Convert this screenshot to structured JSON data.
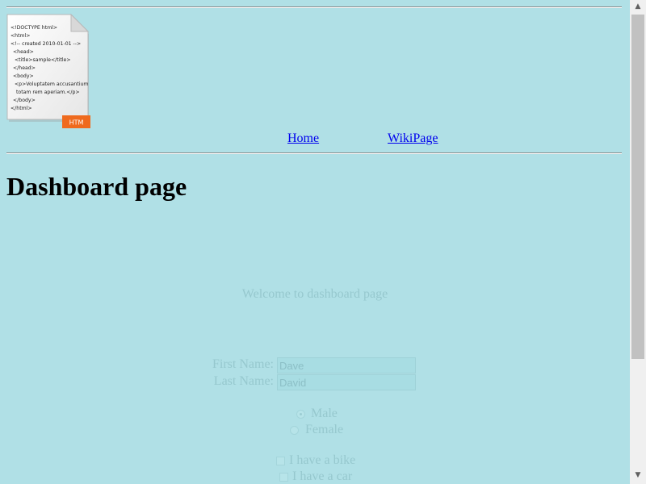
{
  "header": {
    "logo_badge": "HTM",
    "logo_lines": [
      "<!DOCTYPE html>",
      "<html>",
      "<!-- created 2010-01-01 -->",
      "<head>",
      "<title>sample</title>",
      "</head>",
      "<body>",
      "<p>Voluptatem accusantium",
      "totam rem aperiam.</p>",
      "</body>",
      "</html>"
    ]
  },
  "nav": {
    "home_label": "Home",
    "wiki_label": "WikiPage"
  },
  "main": {
    "title": "Dashboard page",
    "welcome": "Welcome to dashboard page"
  },
  "form": {
    "first_name_label": "First Name:",
    "first_name_value": "Dave",
    "last_name_label": "Last Name:",
    "last_name_value": "David",
    "gender_options": [
      {
        "label": "Male",
        "checked": true
      },
      {
        "label": "Female",
        "checked": false
      }
    ],
    "vehicles": [
      {
        "label": "I have a bike",
        "checked": false
      },
      {
        "label": "I have a car",
        "checked": false
      }
    ]
  },
  "scrollbar": {
    "up_icon": "triangle-up",
    "down_icon": "triangle-down"
  }
}
